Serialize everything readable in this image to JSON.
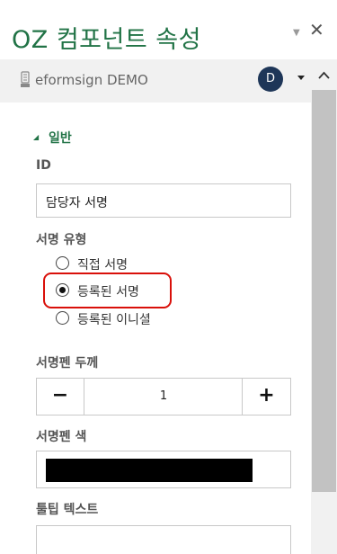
{
  "panel": {
    "title": "OZ 컴포넌트 속성",
    "pin_glyph": "▼",
    "close_glyph": "✕"
  },
  "account": {
    "name": "eformsign DEMO",
    "avatar_initial": "D"
  },
  "section": {
    "toggle_glyph": "◢",
    "title": "일반"
  },
  "fields": {
    "id_label": "ID",
    "id_value": "담당자 서명",
    "sign_type_label": "서명 유형",
    "sign_type_options": [
      {
        "label": "직접 서명",
        "selected": false
      },
      {
        "label": "등록된 서명",
        "selected": true
      },
      {
        "label": "등록된 이니셜",
        "selected": false
      }
    ],
    "pen_thickness_label": "서명펜 두께",
    "pen_thickness_minus": "−",
    "pen_thickness_value": "1",
    "pen_thickness_plus": "+",
    "pen_color_label": "서명펜 색",
    "pen_color": "#000000",
    "tooltip_label": "툴팁 텍스트",
    "tooltip_value": ""
  },
  "colors": {
    "accent": "#217346",
    "highlight": "#d9100a",
    "avatar": "#1e3658"
  }
}
